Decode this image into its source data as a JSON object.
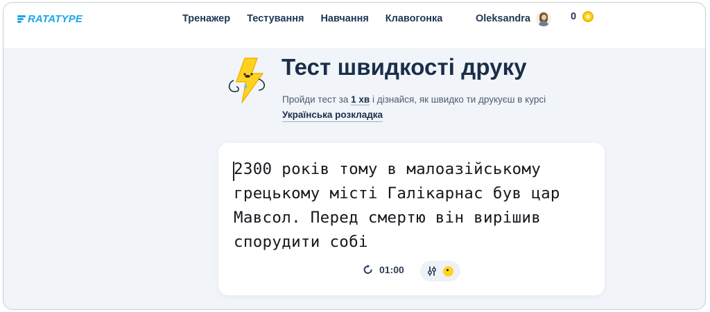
{
  "header": {
    "logo": "RATATYPE",
    "nav": [
      "Тренажер",
      "Тестування",
      "Навчання",
      "Клавогонка"
    ],
    "user_name": "Oleksandra",
    "coins": "0"
  },
  "hero": {
    "title": "Тест швидкості друку",
    "subtitle_prefix": "Пройди тест за ",
    "subtitle_duration": "1 хв",
    "subtitle_suffix": " і дізнайся, як швидко ти друкуєш в курсі",
    "course_link": "Українська розкладка"
  },
  "test": {
    "text": "2300 років тому в малоазійському грецькому місті Галікарнас був цар Мавсол. Перед смертю він вирішив спорудити собі",
    "timer": "01:00"
  },
  "colors": {
    "brand": "#1aa5e6",
    "text_dark": "#1a2e4a",
    "coin": "#ffd21f",
    "page_bg": "#f1f4f8"
  },
  "icons": [
    "ratatype-logo-icon",
    "avatar",
    "coin-icon",
    "lightning-mascot-icon",
    "restart-icon",
    "sliders-icon",
    "coin-face-icon"
  ]
}
